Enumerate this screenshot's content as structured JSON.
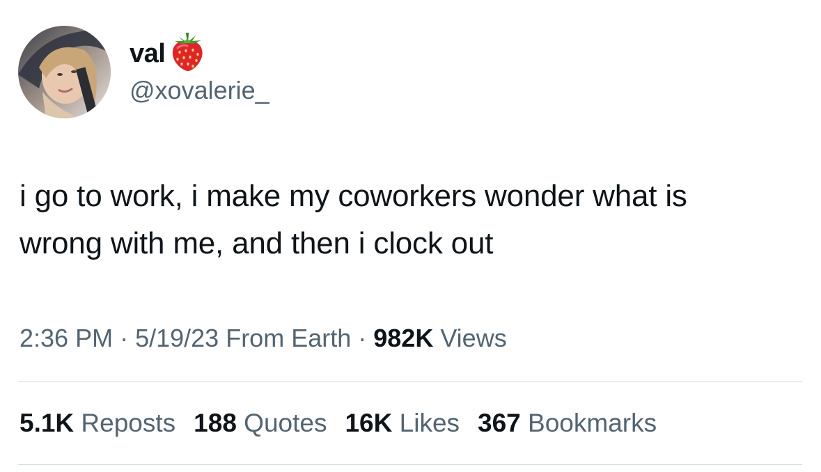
{
  "author": {
    "display_name": "val",
    "emoji": "strawberry-emoji",
    "handle": "@xovalerie_"
  },
  "tweet": {
    "text_line1": "i go to work, i make my coworkers wonder what is",
    "text_line2": "wrong with me, and then i clock out"
  },
  "meta": {
    "time": "2:36 PM",
    "sep1": " · ",
    "date": "5/19/23",
    "source": " From Earth",
    "sep2": " · ",
    "views_count": "982K",
    "views_label": " Views"
  },
  "stats": [
    {
      "count": "5.1K",
      "label": " Reposts"
    },
    {
      "count": "188",
      "label": " Quotes"
    },
    {
      "count": "16K",
      "label": " Likes"
    },
    {
      "count": "367",
      "label": " Bookmarks"
    }
  ],
  "colors": {
    "text_primary": "#0f1419",
    "text_secondary": "#536471",
    "divider": "#cfd9de",
    "strawberry": "#e0242b"
  }
}
